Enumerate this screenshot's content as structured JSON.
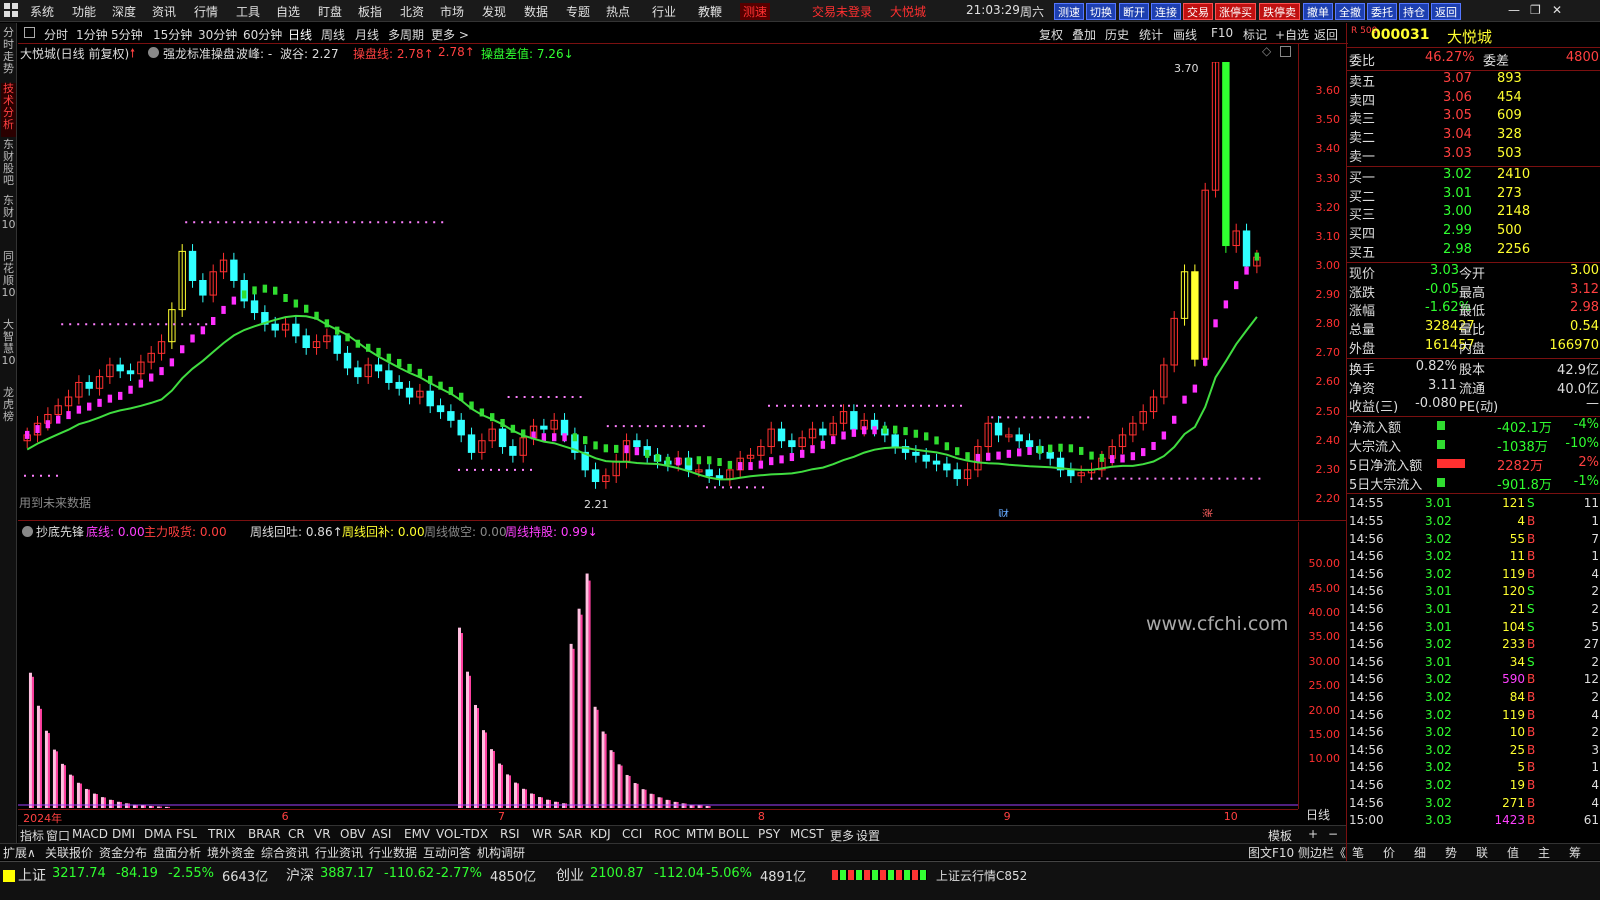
{
  "menu": {
    "items": [
      "系统",
      "功能",
      "深度",
      "资讯",
      "行情",
      "工具",
      "自选",
      "盯盘",
      "板指",
      "北资",
      "市场",
      "发现",
      "数据",
      "专题",
      "热点",
      "行业",
      "教鞭"
    ],
    "test_label": "测速",
    "notice": "交易未登录",
    "name_red": "大悦城",
    "clock": "21:03:29",
    "weekday": "周六",
    "quick": [
      "测速",
      "切换",
      "断开",
      "连接",
      "交易",
      "涨停买",
      "跌停卖",
      "撤单",
      "全撤",
      "委托",
      "持仓",
      "返回"
    ]
  },
  "leftstrip": [
    "分时走势",
    "技术分析",
    "东财股吧",
    "东财10",
    "同花顺10",
    "大智慧10",
    "龙虎榜"
  ],
  "periods": [
    "分时",
    "1分钟",
    "5分钟",
    "15分钟",
    "30分钟",
    "60分钟",
    "日线",
    "周线",
    "月线",
    "多周期",
    "更多 >"
  ],
  "toolbar": [
    "复权",
    "叠加",
    "历史",
    "统计",
    "画线",
    "F10",
    "标记",
    "+自选",
    "返回"
  ],
  "main_info": {
    "title": "大悦城(日线 前复权)",
    "formula": "强龙标准操盘",
    "peak": "波峰: -",
    "valley": "波谷: 2.27",
    "line1": "操盘线: 2.78↑",
    "line1b": "2.78↑",
    "line2": "操盘差值: 7.26↓",
    "future": "用到未来数据",
    "high_mark": "3.70",
    "low_mark": "2.21",
    "cai": "财",
    "zhang": "涨"
  },
  "sub_info": {
    "name": "抄底先锋",
    "f1": "底线: 0.00",
    "f2": "主力吸货: 0.00",
    "f3": "周线回吐: 0.86↑",
    "f4": "周线回补: 0.00",
    "f5": "周线做空: 0.00",
    "f6": "周线持股: 0.99↓",
    "watermark": "www.cfchi.com",
    "period_label": "日线"
  },
  "yaxis_main": [
    "3.60",
    "3.50",
    "3.40",
    "3.30",
    "3.20",
    "3.10",
    "3.00",
    "2.90",
    "2.80",
    "2.70",
    "2.60",
    "2.50",
    "2.40",
    "2.30",
    "2.20"
  ],
  "yaxis_sub": [
    "50.00",
    "45.00",
    "40.00",
    "35.00",
    "30.00",
    "25.00",
    "20.00",
    "15.00",
    "10.00"
  ],
  "dates": [
    {
      "t": "2024年",
      "p": 0.004
    },
    {
      "t": "6",
      "p": 0.206
    },
    {
      "t": "7",
      "p": 0.375
    },
    {
      "t": "8",
      "p": 0.578
    },
    {
      "t": "9",
      "p": 0.77
    },
    {
      "t": "10",
      "p": 0.942
    }
  ],
  "indicators": [
    "指标",
    "窗口",
    "MACD",
    "DMI",
    "DMA",
    "FSL",
    "TRIX",
    "BRAR",
    "CR",
    "VR",
    "OBV",
    "ASI",
    "EMV",
    "VOL-TDX",
    "RSI",
    "WR",
    "SAR",
    "KDJ",
    "CCI",
    "ROC",
    "MTM",
    "BOLL",
    "PSY",
    "MCST",
    "更多",
    "设置"
  ],
  "ind_right": [
    "模板",
    "+",
    "−"
  ],
  "ext": [
    "扩展∧",
    "关联报价",
    "资金分布",
    "盘面分析",
    "境外资金",
    "综合资讯",
    "行业资讯",
    "行业数据",
    "互动问答",
    "机构调研"
  ],
  "ext_right": "图文F10 侧边栏《",
  "ext_tabs": [
    "笔",
    "价",
    "细",
    "势",
    "联",
    "值",
    "主",
    "筹"
  ],
  "status": [
    {
      "n": "上证",
      "v": "3217.74",
      "c": "-84.19",
      "p": "-2.55%",
      "a": "6643亿"
    },
    {
      "n": "沪深",
      "v": "3887.17",
      "c": "-110.62",
      "p": "-2.77%",
      "a": "4850亿"
    },
    {
      "n": "创业",
      "v": "2100.87",
      "c": "-112.04",
      "p": "-5.06%",
      "a": "4891亿"
    }
  ],
  "status_cloud": "上证云行情C852",
  "quote": {
    "code": "000031",
    "name": "大悦城",
    "ratio_label": "委比",
    "ratio": "46.27%",
    "diff_label": "委差",
    "diff": "4800",
    "asks": [
      {
        "l": "卖五",
        "p": "3.07",
        "v": "893"
      },
      {
        "l": "卖四",
        "p": "3.06",
        "v": "454"
      },
      {
        "l": "卖三",
        "p": "3.05",
        "v": "609"
      },
      {
        "l": "卖二",
        "p": "3.04",
        "v": "328"
      },
      {
        "l": "卖一",
        "p": "3.03",
        "v": "503"
      }
    ],
    "bids": [
      {
        "l": "买一",
        "p": "3.02",
        "v": "2410"
      },
      {
        "l": "买二",
        "p": "3.01",
        "v": "273"
      },
      {
        "l": "买三",
        "p": "3.00",
        "v": "2148"
      },
      {
        "l": "买四",
        "p": "2.99",
        "v": "500"
      },
      {
        "l": "买五",
        "p": "2.98",
        "v": "2256"
      }
    ],
    "stats": [
      [
        "现价",
        "3.03",
        "今开",
        "3.00"
      ],
      [
        "涨跌",
        "-0.05",
        "最高",
        "3.12"
      ],
      [
        "涨幅",
        "-1.62%",
        "最低",
        "2.98"
      ],
      [
        "总量",
        "328427",
        "量比",
        "0.54"
      ],
      [
        "外盘",
        "161457",
        "内盘",
        "166970"
      ]
    ],
    "stats2": [
      [
        "换手",
        "0.82%",
        "股本",
        "42.9亿"
      ],
      [
        "净资",
        "3.11",
        "流通",
        "40.0亿"
      ],
      [
        "收益(三)",
        "-0.080",
        "PE(动)",
        "—"
      ]
    ],
    "flows": [
      [
        "净流入额",
        "-402.1万",
        "-4%"
      ],
      [
        "大宗流入",
        "-1038万",
        "-10%"
      ],
      [
        "5日净流入额",
        "2282万",
        "2%"
      ],
      [
        "5日大宗流入",
        "-901.8万",
        "-1%"
      ]
    ],
    "ticks": [
      [
        "14:55",
        "3.01",
        "121",
        "S",
        "11"
      ],
      [
        "14:55",
        "3.02",
        "4",
        "B",
        "1"
      ],
      [
        "14:56",
        "3.02",
        "55",
        "B",
        "7"
      ],
      [
        "14:56",
        "3.02",
        "11",
        "B",
        "1"
      ],
      [
        "14:56",
        "3.02",
        "119",
        "B",
        "4"
      ],
      [
        "14:56",
        "3.01",
        "120",
        "S",
        "2"
      ],
      [
        "14:56",
        "3.01",
        "21",
        "S",
        "2"
      ],
      [
        "14:56",
        "3.01",
        "104",
        "S",
        "5"
      ],
      [
        "14:56",
        "3.02",
        "233",
        "B",
        "27"
      ],
      [
        "14:56",
        "3.01",
        "34",
        "S",
        "2"
      ],
      [
        "14:56",
        "3.02",
        "590",
        "B",
        "12"
      ],
      [
        "14:56",
        "3.02",
        "84",
        "B",
        "2"
      ],
      [
        "14:56",
        "3.02",
        "119",
        "B",
        "4"
      ],
      [
        "14:56",
        "3.02",
        "10",
        "B",
        "2"
      ],
      [
        "14:56",
        "3.02",
        "25",
        "B",
        "3"
      ],
      [
        "14:56",
        "3.02",
        "5",
        "B",
        "1"
      ],
      [
        "14:56",
        "3.02",
        "19",
        "B",
        "4"
      ],
      [
        "14:56",
        "3.02",
        "271",
        "B",
        "4"
      ],
      [
        "15:00",
        "3.03",
        "1423",
        "B",
        "61"
      ]
    ]
  },
  "chart_data": {
    "type": "candlestick",
    "ylim": [
      2.2,
      3.7
    ],
    "closes": [
      2.42,
      2.46,
      2.49,
      2.52,
      2.55,
      2.6,
      2.58,
      2.62,
      2.66,
      2.64,
      2.63,
      2.67,
      2.7,
      2.74,
      2.85,
      3.05,
      2.95,
      2.9,
      2.98,
      3.02,
      2.95,
      2.88,
      2.84,
      2.8,
      2.78,
      2.8,
      2.76,
      2.72,
      2.74,
      2.76,
      2.7,
      2.65,
      2.62,
      2.66,
      2.64,
      2.6,
      2.58,
      2.55,
      2.57,
      2.52,
      2.5,
      2.47,
      2.42,
      2.36,
      2.4,
      2.44,
      2.38,
      2.35,
      2.41,
      2.45,
      2.44,
      2.47,
      2.42,
      2.36,
      2.3,
      2.26,
      2.28,
      2.33,
      2.4,
      2.38,
      2.35,
      2.33,
      2.32,
      2.34,
      2.3,
      2.3,
      2.28,
      2.27,
      2.3,
      2.34,
      2.35,
      2.38,
      2.44,
      2.4,
      2.38,
      2.41,
      2.44,
      2.42,
      2.46,
      2.5,
      2.44,
      2.47,
      2.44,
      2.42,
      2.38,
      2.36,
      2.35,
      2.33,
      2.32,
      2.3,
      2.27,
      2.3,
      2.38,
      2.46,
      2.42,
      2.42,
      2.4,
      2.38,
      2.36,
      2.34,
      2.3,
      2.28,
      2.29,
      2.3,
      2.34,
      2.38,
      2.42,
      2.46,
      2.5,
      2.55,
      2.66,
      2.82,
      2.98,
      2.68,
      3.26,
      3.7,
      3.07,
      3.12,
      3.0,
      3.03
    ],
    "series": [
      {
        "name": "操盘线"
      }
    ],
    "sub_spikes": [
      {
        "x": 0.004,
        "h": 30
      },
      {
        "x": 0.35,
        "h": 40
      },
      {
        "x": 0.44,
        "h": 52
      }
    ],
    "sub_ylim": [
      0,
      55
    ]
  }
}
